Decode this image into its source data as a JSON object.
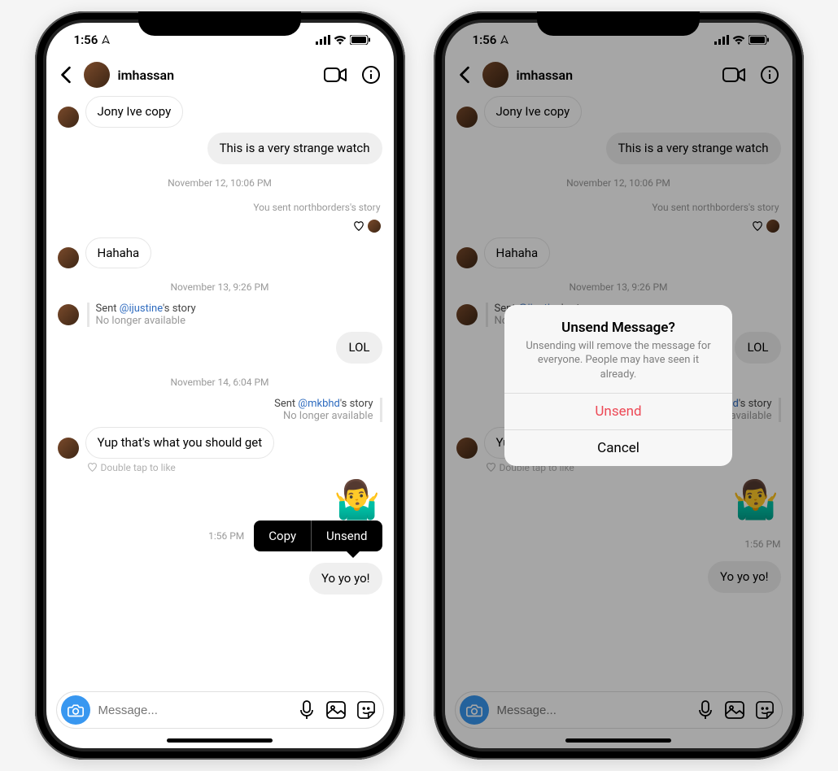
{
  "status": {
    "time": "1:56",
    "nav_icon": "◌"
  },
  "header": {
    "username": "imhassan"
  },
  "messages": {
    "m1": "Jony Ive copy",
    "m2": "This is a very strange watch",
    "ts1": "November 12, 10:06 PM",
    "story_sent_1": "You sent northborders's story",
    "m3": "Hahaha",
    "ts2": "November 13, 9:26 PM",
    "story_ref_1_prefix": "Sent ",
    "story_ref_1_mention": "@ijustine",
    "story_ref_1_suffix": "'s story",
    "not_available": "No longer available",
    "m4": "LOL",
    "ts3": "November 14, 6:04 PM",
    "story_ref_2_prefix": "Sent ",
    "story_ref_2_mention": "@mkbhd",
    "story_ref_2_suffix": "'s story",
    "m5": "Yup that's what you should get",
    "like_hint": "Double tap to like",
    "emoji": "🤷‍♂️",
    "pop_time": "1:56 PM",
    "pop_copy": "Copy",
    "pop_unsend": "Unsend",
    "m6": "Yo yo yo!"
  },
  "composer": {
    "placeholder": "Message..."
  },
  "alert": {
    "title": "Unsend Message?",
    "body": "Unsending will remove the message for everyone. People may have seen it already.",
    "unsend": "Unsend",
    "cancel": "Cancel"
  }
}
